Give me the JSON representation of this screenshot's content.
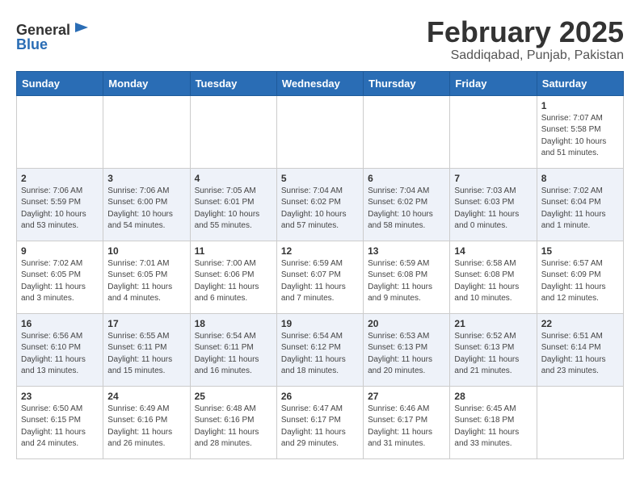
{
  "header": {
    "logo_general": "General",
    "logo_blue": "Blue",
    "month_year": "February 2025",
    "location": "Saddiqabad, Punjab, Pakistan"
  },
  "weekdays": [
    "Sunday",
    "Monday",
    "Tuesday",
    "Wednesday",
    "Thursday",
    "Friday",
    "Saturday"
  ],
  "weeks": [
    [
      {
        "day": "",
        "info": ""
      },
      {
        "day": "",
        "info": ""
      },
      {
        "day": "",
        "info": ""
      },
      {
        "day": "",
        "info": ""
      },
      {
        "day": "",
        "info": ""
      },
      {
        "day": "",
        "info": ""
      },
      {
        "day": "1",
        "info": "Sunrise: 7:07 AM\nSunset: 5:58 PM\nDaylight: 10 hours and 51 minutes."
      }
    ],
    [
      {
        "day": "2",
        "info": "Sunrise: 7:06 AM\nSunset: 5:59 PM\nDaylight: 10 hours and 53 minutes."
      },
      {
        "day": "3",
        "info": "Sunrise: 7:06 AM\nSunset: 6:00 PM\nDaylight: 10 hours and 54 minutes."
      },
      {
        "day": "4",
        "info": "Sunrise: 7:05 AM\nSunset: 6:01 PM\nDaylight: 10 hours and 55 minutes."
      },
      {
        "day": "5",
        "info": "Sunrise: 7:04 AM\nSunset: 6:02 PM\nDaylight: 10 hours and 57 minutes."
      },
      {
        "day": "6",
        "info": "Sunrise: 7:04 AM\nSunset: 6:02 PM\nDaylight: 10 hours and 58 minutes."
      },
      {
        "day": "7",
        "info": "Sunrise: 7:03 AM\nSunset: 6:03 PM\nDaylight: 11 hours and 0 minutes."
      },
      {
        "day": "8",
        "info": "Sunrise: 7:02 AM\nSunset: 6:04 PM\nDaylight: 11 hours and 1 minute."
      }
    ],
    [
      {
        "day": "9",
        "info": "Sunrise: 7:02 AM\nSunset: 6:05 PM\nDaylight: 11 hours and 3 minutes."
      },
      {
        "day": "10",
        "info": "Sunrise: 7:01 AM\nSunset: 6:05 PM\nDaylight: 11 hours and 4 minutes."
      },
      {
        "day": "11",
        "info": "Sunrise: 7:00 AM\nSunset: 6:06 PM\nDaylight: 11 hours and 6 minutes."
      },
      {
        "day": "12",
        "info": "Sunrise: 6:59 AM\nSunset: 6:07 PM\nDaylight: 11 hours and 7 minutes."
      },
      {
        "day": "13",
        "info": "Sunrise: 6:59 AM\nSunset: 6:08 PM\nDaylight: 11 hours and 9 minutes."
      },
      {
        "day": "14",
        "info": "Sunrise: 6:58 AM\nSunset: 6:08 PM\nDaylight: 11 hours and 10 minutes."
      },
      {
        "day": "15",
        "info": "Sunrise: 6:57 AM\nSunset: 6:09 PM\nDaylight: 11 hours and 12 minutes."
      }
    ],
    [
      {
        "day": "16",
        "info": "Sunrise: 6:56 AM\nSunset: 6:10 PM\nDaylight: 11 hours and 13 minutes."
      },
      {
        "day": "17",
        "info": "Sunrise: 6:55 AM\nSunset: 6:11 PM\nDaylight: 11 hours and 15 minutes."
      },
      {
        "day": "18",
        "info": "Sunrise: 6:54 AM\nSunset: 6:11 PM\nDaylight: 11 hours and 16 minutes."
      },
      {
        "day": "19",
        "info": "Sunrise: 6:54 AM\nSunset: 6:12 PM\nDaylight: 11 hours and 18 minutes."
      },
      {
        "day": "20",
        "info": "Sunrise: 6:53 AM\nSunset: 6:13 PM\nDaylight: 11 hours and 20 minutes."
      },
      {
        "day": "21",
        "info": "Sunrise: 6:52 AM\nSunset: 6:13 PM\nDaylight: 11 hours and 21 minutes."
      },
      {
        "day": "22",
        "info": "Sunrise: 6:51 AM\nSunset: 6:14 PM\nDaylight: 11 hours and 23 minutes."
      }
    ],
    [
      {
        "day": "23",
        "info": "Sunrise: 6:50 AM\nSunset: 6:15 PM\nDaylight: 11 hours and 24 minutes."
      },
      {
        "day": "24",
        "info": "Sunrise: 6:49 AM\nSunset: 6:16 PM\nDaylight: 11 hours and 26 minutes."
      },
      {
        "day": "25",
        "info": "Sunrise: 6:48 AM\nSunset: 6:16 PM\nDaylight: 11 hours and 28 minutes."
      },
      {
        "day": "26",
        "info": "Sunrise: 6:47 AM\nSunset: 6:17 PM\nDaylight: 11 hours and 29 minutes."
      },
      {
        "day": "27",
        "info": "Sunrise: 6:46 AM\nSunset: 6:17 PM\nDaylight: 11 hours and 31 minutes."
      },
      {
        "day": "28",
        "info": "Sunrise: 6:45 AM\nSunset: 6:18 PM\nDaylight: 11 hours and 33 minutes."
      },
      {
        "day": "",
        "info": ""
      }
    ]
  ]
}
